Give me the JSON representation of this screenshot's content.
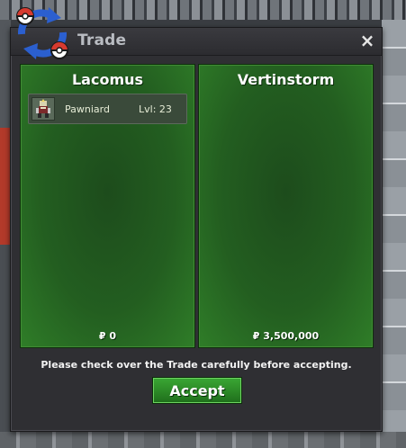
{
  "window": {
    "title": "Trade",
    "close_glyph": "×"
  },
  "left_panel": {
    "player_name": "Lacomus",
    "items": [
      {
        "name": "Pawniard",
        "level_text": "Lvl: 23",
        "icon": "pawniard-sprite-icon"
      }
    ],
    "money": "₽ 0"
  },
  "right_panel": {
    "player_name": "Vertinstorm",
    "items": [],
    "money": "₽ 3,500,000"
  },
  "footer": {
    "notice": "Please check over the Trade carefully before accepting.",
    "accept_label": "Accept"
  },
  "colors": {
    "panel_green": "#235e20",
    "accept_green": "#2f8f2a",
    "window_bg": "#2f2f33",
    "trade_icon_blue": "#2b5fcf",
    "trade_icon_red": "#d63a2f"
  }
}
